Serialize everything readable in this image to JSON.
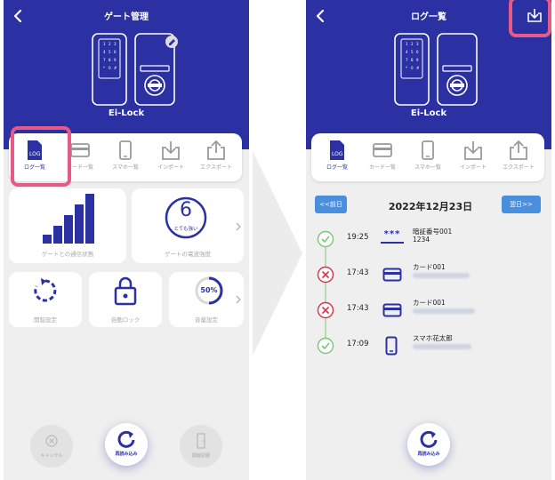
{
  "left_screen": {
    "title": "ゲート管理",
    "device_name": "Ei-Lock",
    "tabs": [
      {
        "label": "ログ一覧",
        "icon": "log-file-icon"
      },
      {
        "label": "カード一覧",
        "icon": "card-icon"
      },
      {
        "label": "スマホ一覧",
        "icon": "smartphone-icon"
      },
      {
        "label": "インポート",
        "icon": "import-icon"
      },
      {
        "label": "エクスポート",
        "icon": "export-icon"
      }
    ],
    "tab_log_badge": "LOG",
    "signal_label": "ゲートとの通信状態",
    "signal_level": 4,
    "radio_value": "6",
    "radio_sub": "とても強い",
    "radio_label": "ゲートの電波強度",
    "unlock_label": "開錠設定",
    "autolock_label": "自動ロック",
    "volume_value": "50%",
    "volume_level": 0.5,
    "volume_label": "音量設定",
    "cancel_label": "キャンセル",
    "reload_label": "再読み込み",
    "door_label": "開錠記録"
  },
  "right_screen": {
    "title": "ログ一覧",
    "device_name": "Ei-Lock",
    "tabs": [
      {
        "label": "ログ一覧",
        "icon": "log-file-icon"
      },
      {
        "label": "カード一覧",
        "icon": "card-icon"
      },
      {
        "label": "スマホ一覧",
        "icon": "smartphone-icon"
      },
      {
        "label": "インポート",
        "icon": "import-icon"
      },
      {
        "label": "エクスポート",
        "icon": "export-icon"
      }
    ],
    "tab_log_badge": "LOG",
    "prev_day": "<<前日",
    "next_day": "翌日>>",
    "date": "2022年12月23日",
    "logs": [
      {
        "status": "success",
        "time": "19:25",
        "type": "pin",
        "type_glyph": "***",
        "primary": "暗証番号001",
        "secondary": "1234"
      },
      {
        "status": "fail",
        "time": "17:43",
        "type": "card",
        "primary": "カード001",
        "secondary": ""
      },
      {
        "status": "fail",
        "time": "17:43",
        "type": "card",
        "primary": "カード001",
        "secondary": ""
      },
      {
        "status": "success",
        "time": "17:09",
        "type": "phone",
        "primary": "スマホ花太郎",
        "secondary": ""
      }
    ],
    "reload_label": "再読み込み"
  },
  "colors": {
    "header_blue": "#2b31a3",
    "highlight_pink": "#e55a86",
    "success_green": "#7cc576",
    "fail_red": "#d8344a",
    "date_button_blue": "#4a8fdd"
  }
}
